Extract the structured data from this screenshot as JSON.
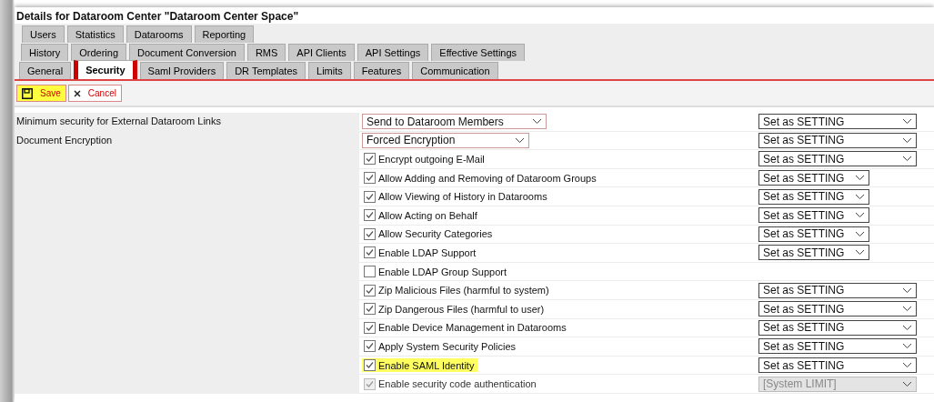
{
  "window": {
    "title": "Details for Dataroom Center \"Dataroom Center Space\""
  },
  "tab_rows": [
    [
      {
        "label": "Users",
        "selected": false
      },
      {
        "label": "Statistics",
        "selected": false
      },
      {
        "label": "Datarooms",
        "selected": false
      },
      {
        "label": "Reporting",
        "selected": false
      }
    ],
    [
      {
        "label": "History",
        "selected": false
      },
      {
        "label": "Ordering",
        "selected": false
      },
      {
        "label": "Document Conversion",
        "selected": false
      },
      {
        "label": "RMS",
        "selected": false
      },
      {
        "label": "API Clients",
        "selected": false
      },
      {
        "label": "API Settings",
        "selected": false
      },
      {
        "label": "Effective Settings",
        "selected": false
      }
    ],
    [
      {
        "label": "General",
        "selected": false
      },
      {
        "label": "Security",
        "selected": true
      },
      {
        "label": "Saml Providers",
        "selected": false
      },
      {
        "label": "DR Templates",
        "selected": false
      },
      {
        "label": "Limits",
        "selected": false
      },
      {
        "label": "Features",
        "selected": false
      },
      {
        "label": "Communication",
        "selected": false
      }
    ]
  ],
  "toolbar": [
    {
      "kind": "save",
      "label": "Save"
    },
    {
      "kind": "cancel",
      "label": "Cancel"
    }
  ],
  "settings": [
    {
      "kind": "select",
      "label": "Minimum security for External Dataroom Links",
      "value": "Send to Dataroom Members",
      "scope": {
        "value": "Set as SETTING",
        "compact": false,
        "disabled": false
      }
    },
    {
      "kind": "select",
      "label": "Document Encryption",
      "value": "Forced Encryption",
      "scope": {
        "value": "Set as SETTING",
        "compact": false,
        "disabled": false
      }
    },
    {
      "kind": "checkbox",
      "label": "Encrypt outgoing E-Mail",
      "checked": true,
      "disabled": false,
      "highlighted": false,
      "scope": {
        "value": "Set as SETTING",
        "compact": false,
        "disabled": false
      }
    },
    {
      "kind": "checkbox",
      "label": "Allow Adding and Removing of Dataroom Groups",
      "checked": true,
      "disabled": false,
      "highlighted": false,
      "scope": {
        "value": "Set as SETTING",
        "compact": true,
        "disabled": false
      }
    },
    {
      "kind": "checkbox",
      "label": "Allow Viewing of History in Datarooms",
      "checked": true,
      "disabled": false,
      "highlighted": false,
      "scope": {
        "value": "Set as SETTING",
        "compact": true,
        "disabled": false
      }
    },
    {
      "kind": "checkbox",
      "label": "Allow Acting on Behalf",
      "checked": true,
      "disabled": false,
      "highlighted": false,
      "scope": {
        "value": "Set as SETTING",
        "compact": true,
        "disabled": false
      }
    },
    {
      "kind": "checkbox",
      "label": "Allow Security Categories",
      "checked": true,
      "disabled": false,
      "highlighted": false,
      "scope": {
        "value": "Set as SETTING",
        "compact": true,
        "disabled": false
      }
    },
    {
      "kind": "checkbox",
      "label": "Enable LDAP Support",
      "checked": true,
      "disabled": false,
      "highlighted": false,
      "scope": {
        "value": "Set as SETTING",
        "compact": true,
        "disabled": false
      }
    },
    {
      "kind": "checkbox",
      "label": "Enable LDAP Group Support",
      "checked": false,
      "disabled": false,
      "highlighted": false
    },
    {
      "kind": "checkbox",
      "label": "Zip Malicious Files (harmful to system)",
      "checked": true,
      "disabled": false,
      "highlighted": false,
      "scope": {
        "value": "Set as SETTING",
        "compact": false,
        "disabled": false
      }
    },
    {
      "kind": "checkbox",
      "label": "Zip Dangerous Files (harmful to user)",
      "checked": true,
      "disabled": false,
      "highlighted": false,
      "scope": {
        "value": "Set as SETTING",
        "compact": false,
        "disabled": false
      }
    },
    {
      "kind": "checkbox",
      "label": "Enable Device Management in Datarooms",
      "checked": true,
      "disabled": false,
      "highlighted": false,
      "scope": {
        "value": "Set as SETTING",
        "compact": false,
        "disabled": false
      }
    },
    {
      "kind": "checkbox",
      "label": "Apply System Security Policies",
      "checked": true,
      "disabled": false,
      "highlighted": false,
      "scope": {
        "value": "Set as SETTING",
        "compact": false,
        "disabled": false
      }
    },
    {
      "kind": "checkbox",
      "label": "Enable SAML Identity",
      "checked": true,
      "disabled": false,
      "highlighted": true,
      "scope": {
        "value": "Set as SETTING",
        "compact": false,
        "disabled": false
      }
    },
    {
      "kind": "checkbox",
      "label": "Enable security code authentication",
      "checked": true,
      "disabled": true,
      "highlighted": false,
      "scope": {
        "value": "[System LIMIT]",
        "compact": false,
        "disabled": true
      }
    }
  ]
}
